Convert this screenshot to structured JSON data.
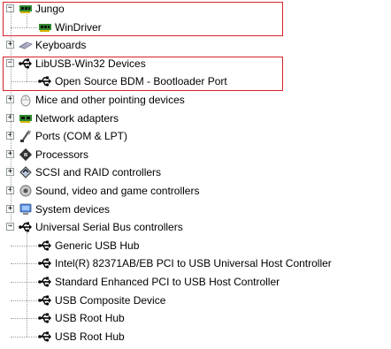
{
  "tree": {
    "groups": [
      {
        "label": "Jungo",
        "icon": "pci-card-icon",
        "expanded": true,
        "children": [
          {
            "label": "WinDriver",
            "icon": "pci-card-icon"
          }
        ]
      },
      {
        "label": "Keyboards",
        "icon": "keyboard-icon",
        "expanded": false
      },
      {
        "label": "LibUSB-Win32 Devices",
        "icon": "usb-icon",
        "expanded": true,
        "children": [
          {
            "label": "Open Source BDM - Bootloader Port",
            "icon": "usb-icon"
          }
        ]
      },
      {
        "label": "Mice and other pointing devices",
        "icon": "mouse-icon",
        "expanded": false
      },
      {
        "label": "Network adapters",
        "icon": "network-adapter-icon",
        "expanded": false
      },
      {
        "label": "Ports (COM & LPT)",
        "icon": "port-icon",
        "expanded": false
      },
      {
        "label": "Processors",
        "icon": "processor-icon",
        "expanded": false
      },
      {
        "label": "SCSI and RAID controllers",
        "icon": "scsi-icon",
        "expanded": false
      },
      {
        "label": "Sound, video and game controllers",
        "icon": "speaker-icon",
        "expanded": false
      },
      {
        "label": "System devices",
        "icon": "computer-icon",
        "expanded": false
      },
      {
        "label": "Universal Serial Bus controllers",
        "icon": "usb-icon",
        "expanded": true,
        "children": [
          {
            "label": "Generic USB Hub",
            "icon": "usb-icon"
          },
          {
            "label": "Intel(R) 82371AB/EB PCI to USB Universal Host Controller",
            "icon": "usb-icon"
          },
          {
            "label": "Standard Enhanced PCI to USB Host Controller",
            "icon": "usb-icon"
          },
          {
            "label": "USB Composite Device",
            "icon": "usb-icon"
          },
          {
            "label": "USB Root Hub",
            "icon": "usb-icon"
          },
          {
            "label": "USB Root Hub",
            "icon": "usb-icon"
          }
        ]
      }
    ]
  },
  "expander_symbols": {
    "expanded": "−",
    "collapsed": "+"
  },
  "highlight_color": "#d4242b"
}
